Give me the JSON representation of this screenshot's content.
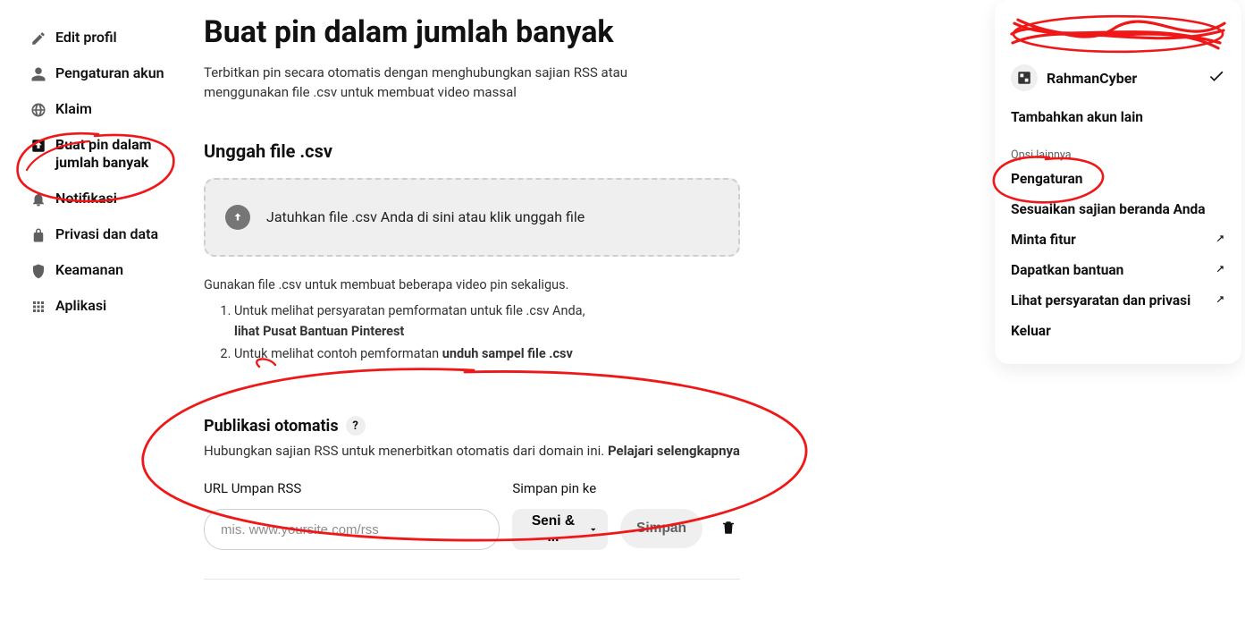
{
  "sidebar": {
    "items": [
      {
        "label": "Edit profil"
      },
      {
        "label": "Pengaturan akun"
      },
      {
        "label": "Klaim"
      },
      {
        "label": "Buat pin dalam jumlah banyak"
      },
      {
        "label": "Notifikasi"
      },
      {
        "label": "Privasi dan data"
      },
      {
        "label": "Keamanan"
      },
      {
        "label": "Aplikasi"
      }
    ]
  },
  "header": {
    "title": "Buat pin dalam jumlah banyak",
    "subtitle": "Terbitkan pin secara otomatis dengan menghubungkan sajian RSS atau menggunakan file .csv untuk membuat video massal"
  },
  "upload": {
    "heading": "Unggah file .csv",
    "drop_text": "Jatuhkan file .csv Anda di sini atau klik unggah file",
    "note_intro": "Gunakan file .csv untuk membuat beberapa video pin sekaligus.",
    "note1_a": "Untuk melihat persyaratan pemformatan untuk file .csv Anda,",
    "note1_b": "lihat Pusat Bantuan Pinterest",
    "note2_a": "Untuk melihat contoh pemformatan ",
    "note2_b": "unduh sampel file .csv"
  },
  "auto": {
    "heading": "Publikasi otomatis",
    "help": "?",
    "subtitle_a": "Hubungkan sajian RSS untuk menerbitkan otomatis dari domain ini. ",
    "subtitle_b": "Pelajari selengkapnya",
    "url_label": "URL Umpan RSS",
    "url_placeholder": "mis. www.yoursite.com/rss",
    "board_label": "Simpan pin ke",
    "board_value": "Seni & ...",
    "save_label": "Simpan"
  },
  "account": {
    "name": "RahmanCyber",
    "add": "Tambahkan akun lain",
    "opsi": "Opsi lainnya",
    "menu": [
      {
        "label": "Pengaturan",
        "ext": false
      },
      {
        "label": "Sesuaikan sajian beranda Anda",
        "ext": false
      },
      {
        "label": "Minta fitur",
        "ext": true
      },
      {
        "label": "Dapatkan bantuan",
        "ext": true
      },
      {
        "label": "Lihat persyaratan dan privasi",
        "ext": true
      },
      {
        "label": "Keluar",
        "ext": false
      }
    ]
  }
}
